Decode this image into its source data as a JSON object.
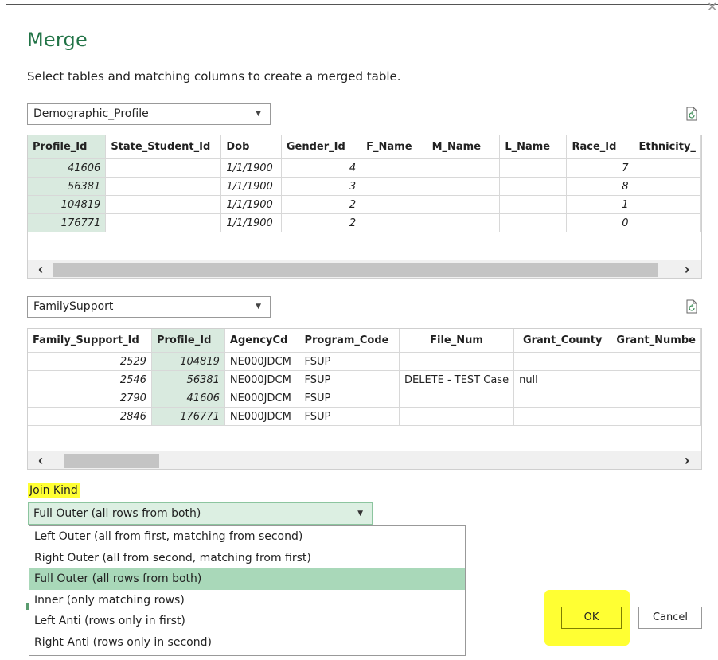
{
  "dialog": {
    "title": "Merge",
    "subtitle": "Select tables and matching columns to create a merged table."
  },
  "table1": {
    "selector": "Demographic_Profile",
    "columns": [
      "Profile_Id",
      "State_Student_Id",
      "Dob",
      "Gender_Id",
      "F_Name",
      "M_Name",
      "L_Name",
      "Race_Id",
      "Ethnicity_"
    ],
    "rows": [
      [
        "41606",
        "",
        "1/1/1900",
        "4",
        "",
        "",
        "",
        "7",
        ""
      ],
      [
        "56381",
        "",
        "1/1/1900",
        "3",
        "",
        "",
        "",
        "8",
        ""
      ],
      [
        "104819",
        "",
        "1/1/1900",
        "2",
        "",
        "",
        "",
        "1",
        ""
      ],
      [
        "176771",
        "",
        "1/1/1900",
        "2",
        "",
        "",
        "",
        "0",
        ""
      ]
    ],
    "selected_column": "Profile_Id"
  },
  "table2": {
    "selector": "FamilySupport",
    "columns": [
      "Family_Support_Id",
      "Profile_Id",
      "AgencyCd",
      "Program_Code",
      "File_Num",
      "Grant_County",
      "Grant_Numbe"
    ],
    "rows": [
      [
        "2529",
        "104819",
        "NE000JDCM",
        "FSUP",
        "",
        "",
        ""
      ],
      [
        "2546",
        "56381",
        "NE000JDCM",
        "FSUP",
        "DELETE - TEST Case",
        "null",
        ""
      ],
      [
        "2790",
        "41606",
        "NE000JDCM",
        "FSUP",
        "",
        "",
        ""
      ],
      [
        "2846",
        "176771",
        "NE000JDCM",
        "FSUP",
        "",
        "",
        ""
      ]
    ],
    "selected_column": "Profile_Id"
  },
  "join": {
    "label": "Join Kind",
    "selected": "Full Outer (all rows from both)",
    "options": [
      "Left Outer (all from first, matching from second)",
      "Right Outer (all from second, matching from first)",
      "Full Outer (all rows from both)",
      "Inner (only matching rows)",
      "Left Anti (rows only in first)",
      "Right Anti (rows only in second)"
    ]
  },
  "buttons": {
    "ok": "OK",
    "cancel": "Cancel"
  },
  "icons": {
    "refresh": "refresh-icon",
    "close": "close-icon",
    "dropdown": "chevron-down-icon",
    "scroll_left": "chevron-left-icon",
    "scroll_right": "chevron-right-icon"
  },
  "colors": {
    "accent": "#217346",
    "selected_column": "#d9eadf",
    "active_option": "#a9d8b9",
    "highlight": "#ffff33"
  }
}
